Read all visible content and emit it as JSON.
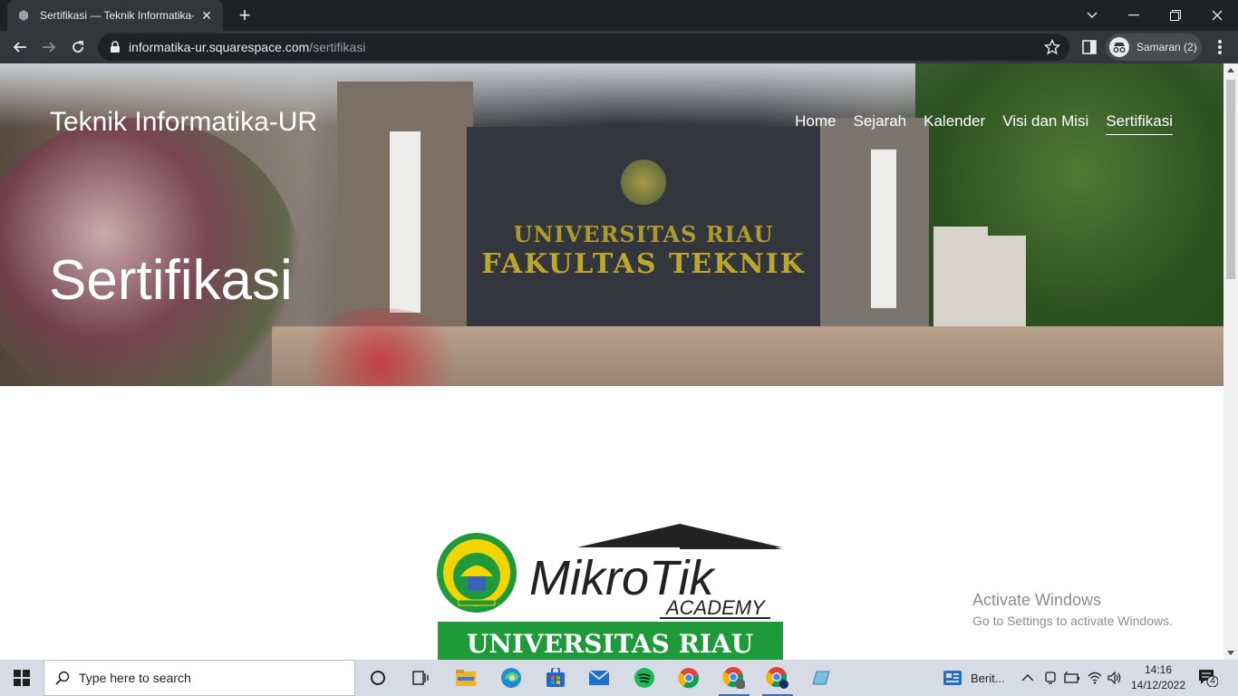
{
  "browser": {
    "tab_title": "Sertifikasi — Teknik Informatika-UR",
    "url_host": "informatika-ur.squarespace.com",
    "url_path": "/sertifikasi",
    "profile_label": "Samaran (2)"
  },
  "site": {
    "title": "Teknik Informatika-UR",
    "nav": [
      {
        "label": "Home",
        "active": false
      },
      {
        "label": "Sejarah",
        "active": false
      },
      {
        "label": "Kalender",
        "active": false
      },
      {
        "label": "Visi dan Misi",
        "active": false
      },
      {
        "label": "Sertifikasi",
        "active": true
      }
    ],
    "hero_heading": "Sertifikasi",
    "hero_sign_line1": "UNIVERSITAS RIAU",
    "hero_sign_line2": "FAKULTAS TEKNIK"
  },
  "logo_banner": {
    "mikrotik_text": "MikroTik",
    "academy_text": "ACADEMY",
    "university_text": "UNIVERSITAS RIAU",
    "colors": {
      "green": "#1e9a3a",
      "dark": "#222222",
      "yellow": "#f2d500"
    }
  },
  "watermark": {
    "line1": "Activate Windows",
    "line2": "Go to Settings to activate Windows."
  },
  "taskbar": {
    "search_placeholder": "Type here to search",
    "news_label": "Berit...",
    "time": "14:16",
    "date": "14/12/2022",
    "notification_count": "4"
  }
}
